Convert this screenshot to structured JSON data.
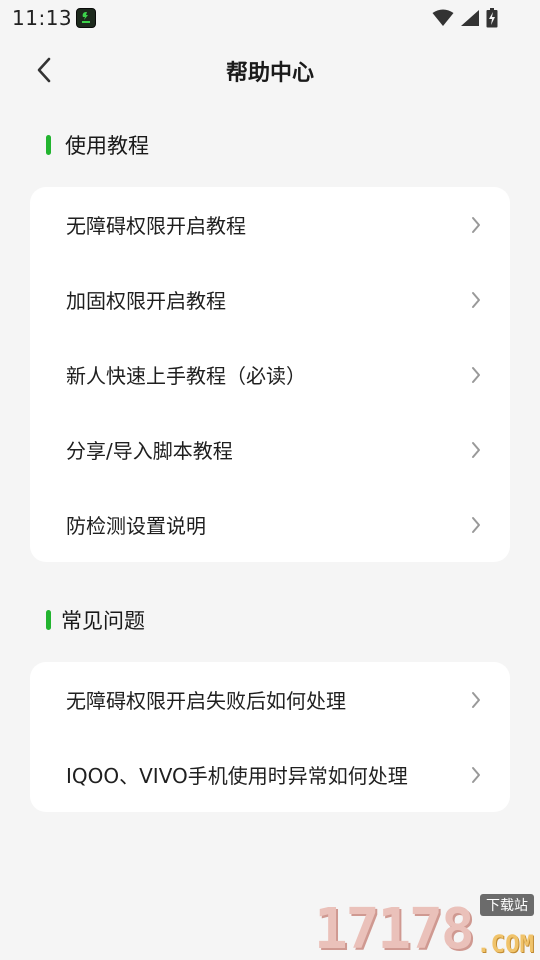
{
  "status_bar": {
    "time": "11:13",
    "app_icon": "app-notification-icon",
    "icons": [
      "wifi-icon",
      "cellular-signal-icon",
      "battery-icon"
    ]
  },
  "header": {
    "back_icon": "chevron-left-icon",
    "title": "帮助中心"
  },
  "sections": [
    {
      "title": "使用教程",
      "accent_color": "#22b42f",
      "items": [
        {
          "label": "无障碍权限开启教程"
        },
        {
          "label": "加固权限开启教程"
        },
        {
          "label": "新人快速上手教程（必读）"
        },
        {
          "label": "分享/导入脚本教程"
        },
        {
          "label": "防检测设置说明"
        }
      ]
    },
    {
      "title": "常见问题",
      "accent_color": "#22b42f",
      "items": [
        {
          "label": "无障碍权限开启失败后如何处理"
        },
        {
          "label": "IQOO、VIVO手机使用时异常如何处理"
        }
      ]
    }
  ],
  "watermark": {
    "digits": "17178",
    "tag": "下载站",
    "domain": ".COM"
  }
}
